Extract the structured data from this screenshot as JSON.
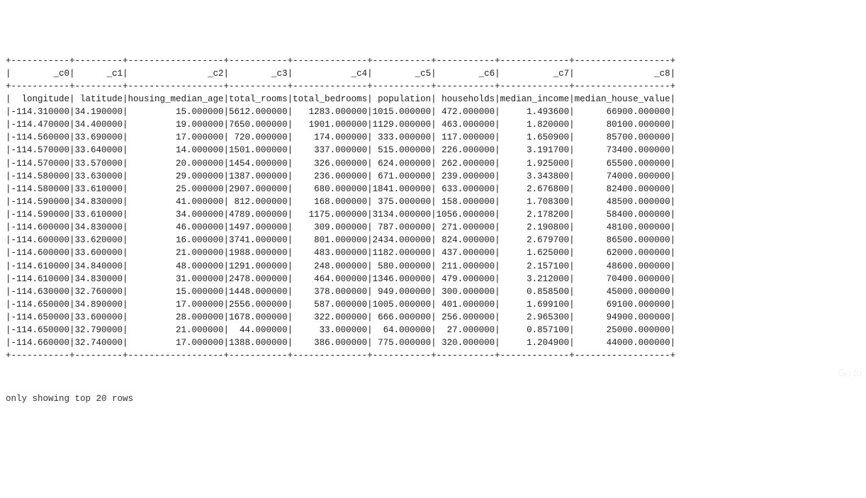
{
  "columns": [
    {
      "name": "_c0",
      "width": 11,
      "field": "longitude"
    },
    {
      "name": "_c1",
      "width": 9,
      "field": "latitude"
    },
    {
      "name": "_c2",
      "width": 18,
      "field": "housing_median_age"
    },
    {
      "name": "_c3",
      "width": 11,
      "field": "total_rooms"
    },
    {
      "name": "_c4",
      "width": 14,
      "field": "total_bedrooms"
    },
    {
      "name": "_c5",
      "width": 11,
      "field": "population"
    },
    {
      "name": "_c6",
      "width": 11,
      "field": "households"
    },
    {
      "name": "_c7",
      "width": 13,
      "field": "median_income"
    },
    {
      "name": "_c8",
      "width": 18,
      "field": "median_house_value"
    }
  ],
  "header_row": [
    "_c0",
    "_c1",
    "_c2",
    "_c3",
    "_c4",
    "_c5",
    "_c6",
    "_c7",
    "_c8"
  ],
  "label_row": [
    "longitude",
    "latitude",
    "housing_median_age",
    "total_rooms",
    "total_bedrooms",
    "population",
    "households",
    "median_income",
    "median_house_value"
  ],
  "rows": [
    [
      "-114.310000",
      "34.190000",
      "15.000000",
      "5612.000000",
      "1283.000000",
      "1015.000000",
      "472.000000",
      "1.493600",
      "66900.000000"
    ],
    [
      "-114.470000",
      "34.400000",
      "19.000000",
      "7650.000000",
      "1901.000000",
      "1129.000000",
      "463.000000",
      "1.820000",
      "80100.000000"
    ],
    [
      "-114.560000",
      "33.690000",
      "17.000000",
      "720.000000",
      "174.000000",
      "333.000000",
      "117.000000",
      "1.650900",
      "85700.000000"
    ],
    [
      "-114.570000",
      "33.640000",
      "14.000000",
      "1501.000000",
      "337.000000",
      "515.000000",
      "226.000000",
      "3.191700",
      "73400.000000"
    ],
    [
      "-114.570000",
      "33.570000",
      "20.000000",
      "1454.000000",
      "326.000000",
      "624.000000",
      "262.000000",
      "1.925000",
      "65500.000000"
    ],
    [
      "-114.580000",
      "33.630000",
      "29.000000",
      "1387.000000",
      "236.000000",
      "671.000000",
      "239.000000",
      "3.343800",
      "74000.000000"
    ],
    [
      "-114.580000",
      "33.610000",
      "25.000000",
      "2907.000000",
      "680.000000",
      "1841.000000",
      "633.000000",
      "2.676800",
      "82400.000000"
    ],
    [
      "-114.590000",
      "34.830000",
      "41.000000",
      "812.000000",
      "168.000000",
      "375.000000",
      "158.000000",
      "1.708300",
      "48500.000000"
    ],
    [
      "-114.590000",
      "33.610000",
      "34.000000",
      "4789.000000",
      "1175.000000",
      "3134.000000",
      "1056.000000",
      "2.178200",
      "58400.000000"
    ],
    [
      "-114.600000",
      "34.830000",
      "46.000000",
      "1497.000000",
      "309.000000",
      "787.000000",
      "271.000000",
      "2.190800",
      "48100.000000"
    ],
    [
      "-114.600000",
      "33.620000",
      "16.000000",
      "3741.000000",
      "801.000000",
      "2434.000000",
      "824.000000",
      "2.679700",
      "86500.000000"
    ],
    [
      "-114.600000",
      "33.600000",
      "21.000000",
      "1988.000000",
      "483.000000",
      "1182.000000",
      "437.000000",
      "1.625000",
      "62000.000000"
    ],
    [
      "-114.610000",
      "34.840000",
      "48.000000",
      "1291.000000",
      "248.000000",
      "580.000000",
      "211.000000",
      "2.157100",
      "48600.000000"
    ],
    [
      "-114.610000",
      "34.830000",
      "31.000000",
      "2478.000000",
      "464.000000",
      "1346.000000",
      "479.000000",
      "3.212000",
      "70400.000000"
    ],
    [
      "-114.630000",
      "32.760000",
      "15.000000",
      "1448.000000",
      "378.000000",
      "949.000000",
      "300.000000",
      "0.858500",
      "45000.000000"
    ],
    [
      "-114.650000",
      "34.890000",
      "17.000000",
      "2556.000000",
      "587.000000",
      "1005.000000",
      "401.000000",
      "1.699100",
      "69100.000000"
    ],
    [
      "-114.650000",
      "33.600000",
      "28.000000",
      "1678.000000",
      "322.000000",
      "666.000000",
      "256.000000",
      "2.965300",
      "94900.000000"
    ],
    [
      "-114.650000",
      "32.790000",
      "21.000000",
      "44.000000",
      "33.000000",
      "64.000000",
      "27.000000",
      "0.857100",
      "25000.000000"
    ],
    [
      "-114.660000",
      "32.740000",
      "17.000000",
      "1388.000000",
      "386.000000",
      "775.000000",
      "320.000000",
      "1.204900",
      "44000.000000"
    ]
  ],
  "footer": "only showing top 20 rows",
  "ghost_text": "Go to"
}
